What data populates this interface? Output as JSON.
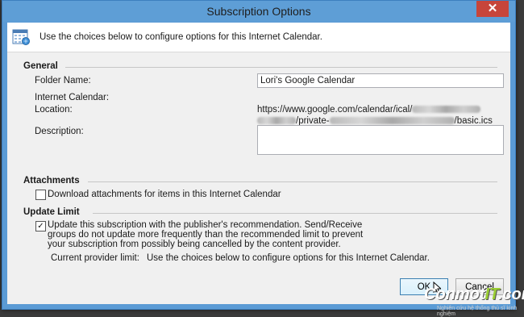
{
  "window": {
    "title": "Subscription Options",
    "close_glyph": "✕"
  },
  "intro": "Use the choices below to configure options for this Internet Calendar.",
  "general": {
    "header": "General",
    "folder_name_label": "Folder Name:",
    "folder_name_value": "Lori's Google Calendar",
    "internet_calendar_label": "Internet Calendar:",
    "location_label": "Location:",
    "location_line1_visible": "https://www.google.com/calendar/ical/",
    "location_line2_visible": "/private-",
    "location_line2_end": "/basic.ics",
    "description_label": "Description:",
    "description_value": ""
  },
  "attachments": {
    "header": "Attachments",
    "download_label": "Download attachments for items in this Internet Calendar",
    "download_checked": false
  },
  "update_limit": {
    "header": "Update Limit",
    "update_text_line1": "Update this subscription with the publisher's recommendation. Send/Receive",
    "update_text_line2": "groups do not update more frequently than the recommended limit to prevent",
    "update_text_line3": "your subscription from possibly being cancelled by the content provider.",
    "update_checked": true,
    "current_limit_label": "Current provider limit:",
    "current_limit_value": "Use the choices below to configure options for this Internet Calendar."
  },
  "buttons": {
    "ok": "OK",
    "cancel": "Cancel"
  },
  "icons": {
    "calendar": "calendar-icon",
    "check": "✓",
    "cursor": "mouse-cursor-icon"
  },
  "watermark": {
    "main_a": "Conmot",
    "main_b": "IT",
    "main_c": ".com",
    "sub": "Nghiên cứu hệ thống thủ sĩ kinh nghiệm"
  },
  "colors": {
    "titlebar": "#5e9ed6",
    "close": "#c7453a",
    "dialog_bg": "#f0f0f0"
  }
}
